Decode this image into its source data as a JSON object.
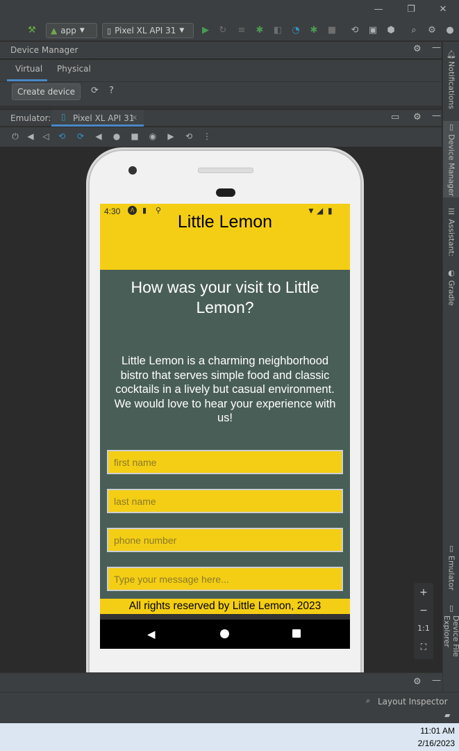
{
  "window": {
    "minimize": "—",
    "maximize": "❐",
    "close": "✕"
  },
  "toolbar": {
    "run_config": "app",
    "device": "Pixel XL API 31"
  },
  "device_manager": {
    "title": "Device Manager",
    "tabs": [
      "Virtual",
      "Physical"
    ],
    "create_button": "Create device",
    "help": "?"
  },
  "emulator": {
    "label": "Emulator:",
    "tab": "Pixel XL API 31"
  },
  "sidebar": {
    "notifications": "Notifications",
    "device_manager": "Device Manager",
    "assistant": "Assistant:",
    "gradle": "Gradle",
    "emulator": "Emulator",
    "device_file_explorer": "Device File Explorer"
  },
  "phone": {
    "status_time": "4:30",
    "app_title": "Little Lemon",
    "headline": "How was your visit to Little Lemon?",
    "description": "Little Lemon is a charming neighborhood bistro that serves simple food and classic cocktails in a lively but casual environment. We would love to hear your experience with us!",
    "fields": [
      {
        "placeholder": "first name"
      },
      {
        "placeholder": "last name"
      },
      {
        "placeholder": "phone number"
      },
      {
        "placeholder": "Type your message here..."
      }
    ],
    "footer": "All rights reserved by Little Lemon, 2023",
    "colors": {
      "yellow": "#f4ce14",
      "green": "#495e57"
    }
  },
  "zoom": {
    "in": "+",
    "out": "−",
    "actual": "1:1"
  },
  "bottom": {
    "layout_inspector": "Layout Inspector"
  },
  "taskbar": {
    "time": "11:01 AM",
    "date": "2/16/2023"
  }
}
